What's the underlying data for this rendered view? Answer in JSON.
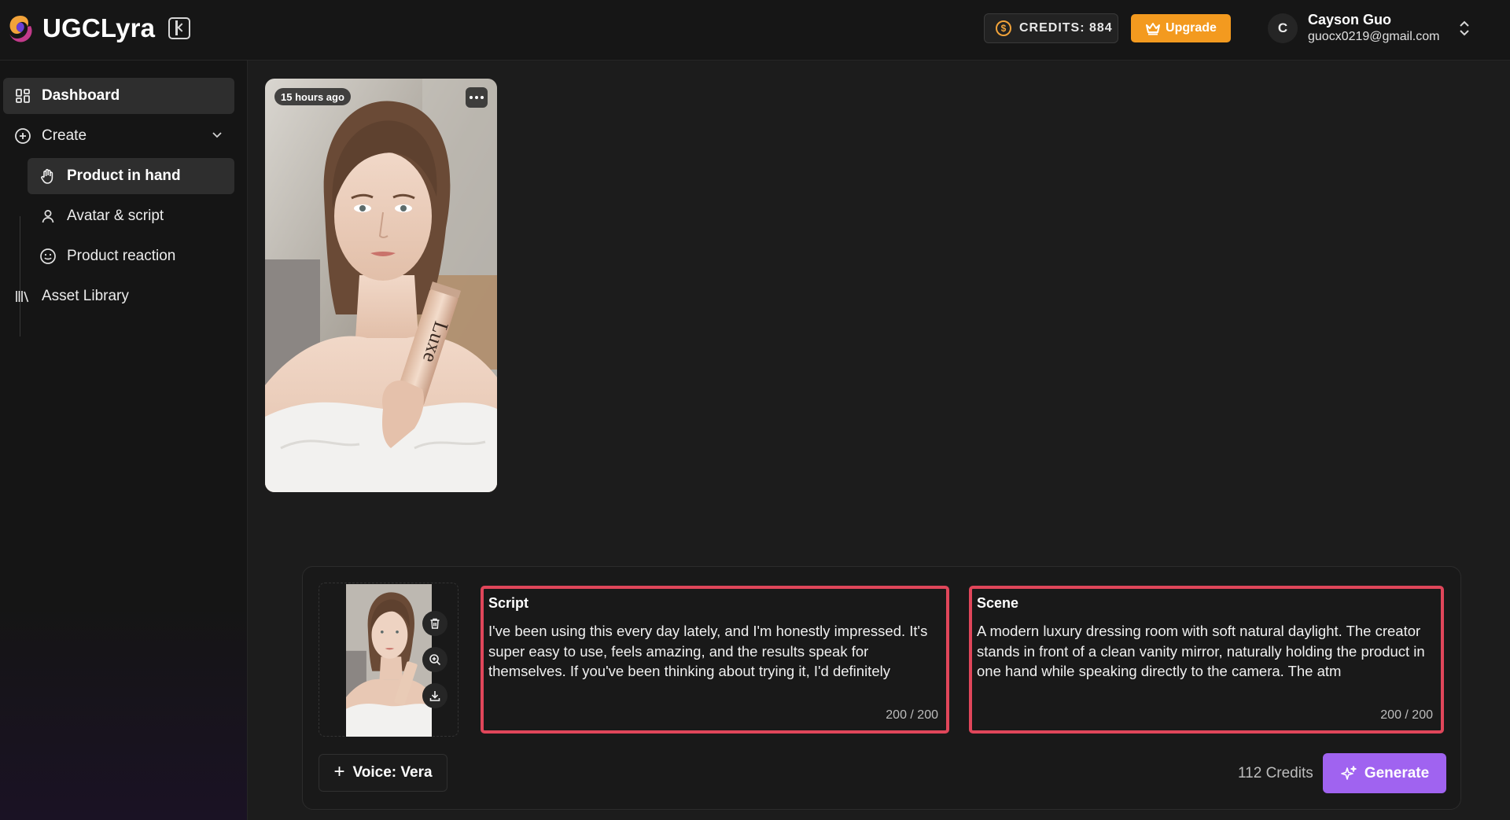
{
  "app": {
    "name": "UGCLyra"
  },
  "header": {
    "credits_label": "CREDITS: 884",
    "upgrade_label": "Upgrade",
    "user": {
      "initial": "C",
      "name": "Cayson Guo",
      "email": "guocx0219@gmail.com"
    }
  },
  "sidebar": {
    "items": [
      {
        "label": "Dashboard",
        "icon": "dashboard-icon",
        "active": true
      },
      {
        "label": "Create",
        "icon": "plus-circle-icon",
        "expandable": true
      },
      {
        "label": "Product in hand",
        "icon": "hand-icon",
        "active": true,
        "sub": true
      },
      {
        "label": "Avatar & script",
        "icon": "user-icon",
        "sub": true
      },
      {
        "label": "Product reaction",
        "icon": "smile-icon",
        "sub": true
      },
      {
        "label": "Asset Library",
        "icon": "library-icon"
      }
    ]
  },
  "gallery": {
    "card": {
      "time": "15 hours ago",
      "product_text": "Luxe"
    }
  },
  "composer": {
    "script": {
      "label": "Script",
      "text": "I've been using this every day lately, and I'm honestly impressed. It's super easy to use, feels amazing, and the results speak for themselves. If you've been thinking about trying it, I'd definitely",
      "counter": "200 / 200"
    },
    "scene": {
      "label": "Scene",
      "text": "A modern luxury dressing room with soft natural daylight. The creator stands in front of a clean vanity mirror, naturally holding the product in one hand while speaking directly to the camera. The atm",
      "counter": "200 / 200"
    },
    "voice_label": "Voice: Vera",
    "cost": "112 Credits",
    "generate_label": "Generate"
  },
  "colors": {
    "accent": "#a063f0",
    "upgrade": "#f39a1f",
    "highlight": "#e0465a"
  }
}
